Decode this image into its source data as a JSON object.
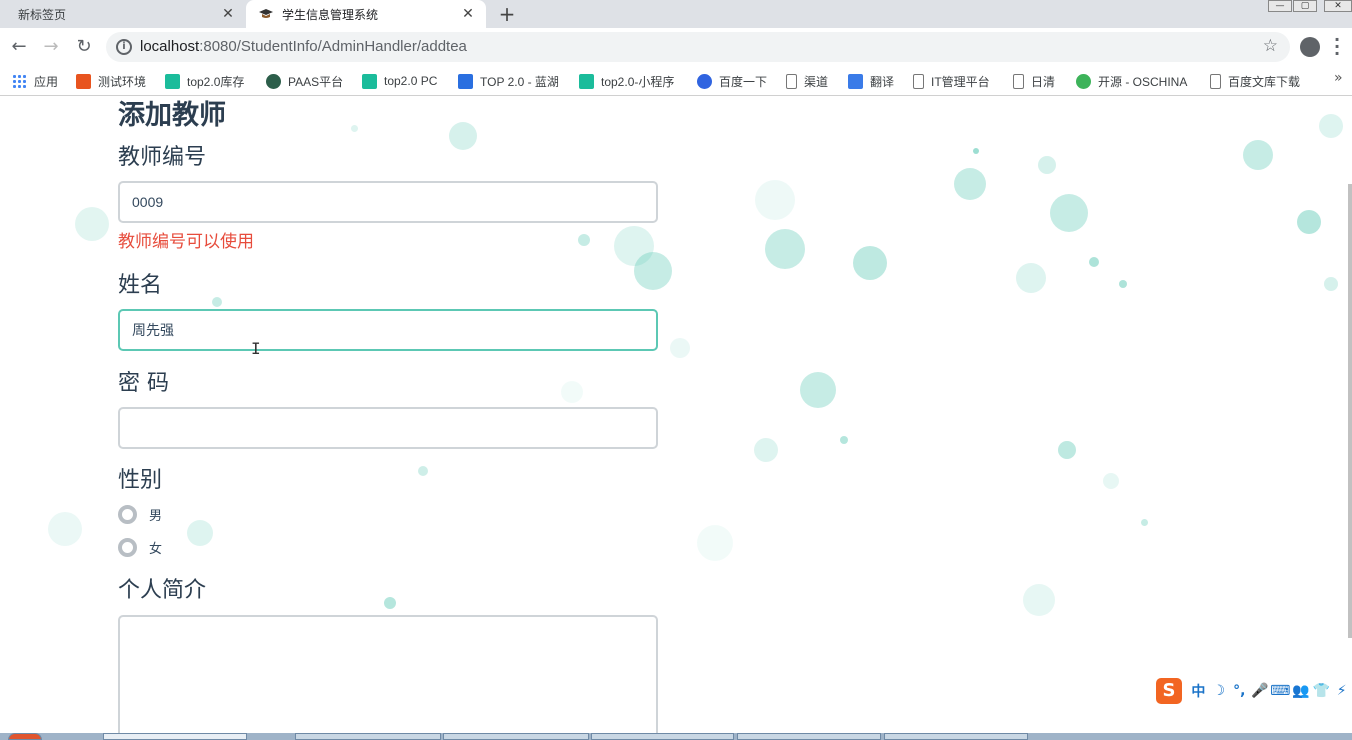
{
  "browser": {
    "tabs": [
      {
        "title": "新标签页",
        "active": false
      },
      {
        "title": "学生信息管理系统",
        "active": true
      }
    ],
    "close_glyph": "✕",
    "new_tab_glyph": "+",
    "url_host": "localhost",
    "url_path": ":8080/StudentInfo/AdminHandler/addtea",
    "bookmarks": [
      {
        "label": "应用",
        "icon": "apps-grid-icon",
        "color": "#4285f4"
      },
      {
        "label": "测试环境",
        "icon": "u-icon",
        "color": "#e8541f"
      },
      {
        "label": "top2.0库存",
        "icon": "play-icon",
        "color": "#1bbc9b"
      },
      {
        "label": "PAAS平台",
        "icon": "paas-icon",
        "color": "#2c5e4a"
      },
      {
        "label": "top2.0 PC",
        "icon": "play-icon",
        "color": "#1bbc9b"
      },
      {
        "label": "TOP 2.0 - 蓝湖",
        "icon": "lanhu-icon",
        "color": "#2a6fe0"
      },
      {
        "label": "top2.0-小程序",
        "icon": "play-icon",
        "color": "#1bbc9b"
      },
      {
        "label": "百度一下",
        "icon": "baidu-paw-icon",
        "color": "#3064e0"
      },
      {
        "label": "渠道",
        "icon": "page-icon",
        "color": "#777777"
      },
      {
        "label": "翻译",
        "icon": "translate-icon",
        "color": "#3a7be8"
      },
      {
        "label": "IT管理平台",
        "icon": "page-icon",
        "color": "#777777"
      },
      {
        "label": "日清",
        "icon": "page-icon",
        "color": "#777777"
      },
      {
        "label": "开源 - OSCHINA",
        "icon": "oschina-icon",
        "color": "#3db35a"
      },
      {
        "label": "百度文库下载",
        "icon": "page-icon",
        "color": "#777777"
      }
    ],
    "more_glyph": "»"
  },
  "form": {
    "title": "添加教师",
    "teacher_id_label": "教师编号",
    "teacher_id_value": "0009",
    "teacher_id_message": "教师编号可以使用",
    "name_label": "姓名",
    "name_value": "周先强",
    "password_label": "密 码",
    "password_value": "",
    "gender_label": "性别",
    "gender_options": [
      "男",
      "女"
    ],
    "bio_label": "个人简介",
    "bio_value": ""
  },
  "ime": {
    "logo": "S",
    "items": [
      "中",
      "☽",
      "°,",
      "🎤",
      "⌨",
      "👥",
      "👕",
      "⚡"
    ]
  },
  "colors": {
    "accent": "#5cc8b4",
    "error": "#e74c3c",
    "text": "#2c3e50"
  }
}
